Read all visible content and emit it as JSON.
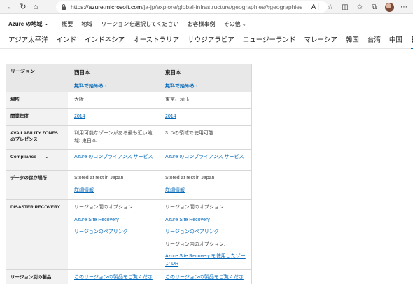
{
  "browser": {
    "url_host": "azure.microsoft.com",
    "url_path": "/ja-jp/explore/global-infrastructure/geographies/#geographies"
  },
  "header": {
    "brand": "Azure の地域",
    "nav": [
      "概要",
      "地域",
      "リージョンを選択してください",
      "お客様事例",
      "その他"
    ]
  },
  "tabs": [
    {
      "label": "アジア太平洋",
      "active": false
    },
    {
      "label": "インド",
      "active": false
    },
    {
      "label": "インドネシア",
      "active": false
    },
    {
      "label": "オーストラリア",
      "active": false
    },
    {
      "label": "サウジアラビア",
      "active": false
    },
    {
      "label": "ニュージーランド",
      "active": false
    },
    {
      "label": "マレーシア",
      "active": false
    },
    {
      "label": "韓国",
      "active": false
    },
    {
      "label": "台湾",
      "active": false
    },
    {
      "label": "中国",
      "active": false
    },
    {
      "label": "日本",
      "active": true
    }
  ],
  "table": {
    "header": {
      "label": "リージョン",
      "regions": [
        {
          "name": "西日本",
          "free": "無料で始める ›"
        },
        {
          "name": "東日本",
          "free": "無料で始める ›"
        }
      ]
    },
    "location": {
      "label": "場所",
      "west": "大阪",
      "east": "東京、埼玉"
    },
    "year": {
      "label": "開業年度",
      "west": "2014",
      "east": "2014"
    },
    "az": {
      "label": "AVAILABILITY ZONES のプレゼンス",
      "west": "利用可能なゾーンがある最も近い地域: 東日本",
      "east": "3 つの領域で使用可能"
    },
    "compliance": {
      "label": "Compliance",
      "west": "Azure のコンプライアンス サービス",
      "east": "Azure のコンプライアンス サービス"
    },
    "data_residency": {
      "label": "データの保存場所",
      "west_text": "Stored at rest in Japan",
      "west_link": "詳細情報",
      "east_text": "Stored at rest in Japan",
      "east_link": "詳細情報"
    },
    "dr": {
      "label": "DISASTER RECOVERY",
      "west_heading": "リージョン間のオプション:",
      "west_link1": "Azure Site Recovery",
      "west_link2": "リージョンのペアリング",
      "east_heading": "リージョン間のオプション:",
      "east_link1": "Azure Site Recovery",
      "east_link2": "リージョンのペアリング",
      "east_heading2": "リージョン内のオプション:",
      "east_link3": "Azure Site Recovery を使用したゾーン DR"
    },
    "products": {
      "label": "リージョン別の製品",
      "west": "このリージョンの製品をご覧くださ",
      "east": "このリージョンの製品をご覧くださ"
    }
  }
}
